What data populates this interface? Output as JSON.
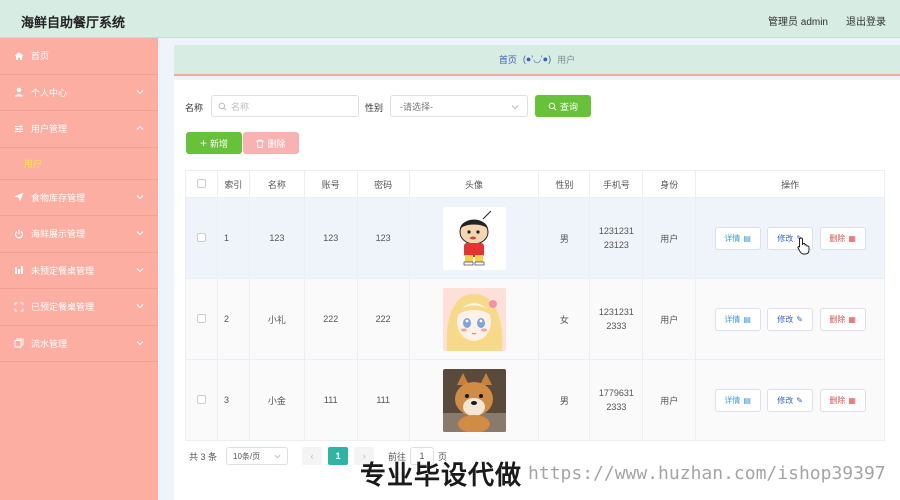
{
  "header": {
    "app_title": "海鲜自助餐厅系统",
    "admin_label": "管理员 admin",
    "logout_label": "退出登录"
  },
  "sidebar": {
    "items": [
      {
        "label": "首页",
        "icon": "home-icon"
      },
      {
        "label": "个人中心",
        "icon": "user-icon"
      },
      {
        "label": "用户管理",
        "icon": "sliders-icon",
        "expanded": true
      },
      {
        "label": "食物库存管理",
        "icon": "send-icon"
      },
      {
        "label": "海鲜展示管理",
        "icon": "power-icon"
      },
      {
        "label": "未预定餐桌管理",
        "icon": "chart-icon"
      },
      {
        "label": "已预定餐桌管理",
        "icon": "frame-icon"
      },
      {
        "label": "流水管理",
        "icon": "copy-icon"
      }
    ],
    "sub_item": "用户"
  },
  "breadcrumb": {
    "home": "首页",
    "face": "(●'◡'●)",
    "current": "用户"
  },
  "search": {
    "name_label": "名称",
    "name_placeholder": "名称",
    "gender_label": "性别",
    "gender_selected": "-请选择-",
    "search_button": "查询"
  },
  "actions": {
    "add_label": "新增",
    "delete_label": "删除"
  },
  "table": {
    "columns": [
      "索引",
      "名称",
      "账号",
      "密码",
      "头像",
      "性别",
      "手机号",
      "身份",
      "操作"
    ],
    "rows": [
      {
        "index": "1",
        "name": "123",
        "account": "123",
        "password": "123",
        "gender": "男",
        "phone_1": "1231231",
        "phone_2": "23123",
        "role": "用户",
        "avatar": "cartoon-boy"
      },
      {
        "index": "2",
        "name": "小礼",
        "account": "222",
        "password": "222",
        "gender": "女",
        "phone_1": "1231231",
        "phone_2": "2333",
        "role": "用户",
        "avatar": "anime-girl"
      },
      {
        "index": "3",
        "name": "小金",
        "account": "111",
        "password": "111",
        "gender": "男",
        "phone_1": "1779631",
        "phone_2": "2333",
        "role": "用户",
        "avatar": "shiba-dog"
      }
    ],
    "row_actions": {
      "detail": "详情",
      "edit": "修改",
      "delete": "删除"
    }
  },
  "pager": {
    "total": "共 3 条",
    "page_size": "10条/页",
    "current_page": "1",
    "jump_prefix": "前往",
    "jump_value": "1",
    "jump_suffix": "页"
  },
  "watermark": {
    "cn": "专业毕设代做",
    "url": "https://www.huzhan.com/ishop39397"
  }
}
